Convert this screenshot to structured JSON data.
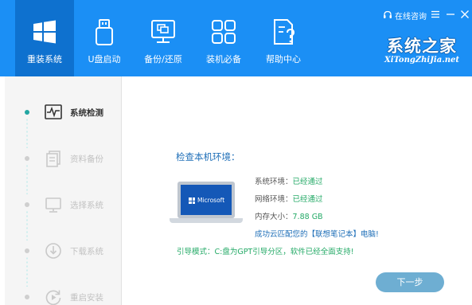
{
  "header": {
    "nav": [
      {
        "label": "重装系统",
        "icon": "windows-logo-icon",
        "active": true
      },
      {
        "label": "U盘启动",
        "icon": "usb-drive-icon",
        "active": false
      },
      {
        "label": "备份/还原",
        "icon": "monitor-backup-icon",
        "active": false
      },
      {
        "label": "装机必备",
        "icon": "apps-grid-icon",
        "active": false
      },
      {
        "label": "帮助中心",
        "icon": "help-document-icon",
        "active": false
      }
    ],
    "consult_label": "在线咨询",
    "brand_title": "系统之家",
    "brand_url": "XiTongZhiJia.net"
  },
  "sidebar": {
    "steps": [
      {
        "label": "系统检测",
        "icon": "pulse-monitor-icon",
        "active": true
      },
      {
        "label": "资料备份",
        "icon": "documents-icon",
        "active": false
      },
      {
        "label": "选择系统",
        "icon": "monitor-icon",
        "active": false
      },
      {
        "label": "下载系统",
        "icon": "download-icon",
        "active": false
      },
      {
        "label": "重启安装",
        "icon": "restart-icon",
        "active": false
      }
    ]
  },
  "main": {
    "check_title": "检查本机环境：",
    "laptop_brand": "Microsoft",
    "system_env": {
      "label": "系统环境：",
      "value": "已经通过"
    },
    "network_env": {
      "label": "网络环境：",
      "value": "已经通过"
    },
    "memory": {
      "label": "内存大小：",
      "value": "7.88 GB"
    },
    "match_message": "成功云匹配您的【联想笔记本】电脑!",
    "boot_message": "引导模式：C:盘为GPT引导分区，软件已经全面支持!",
    "next_button": "下一步"
  },
  "colors": {
    "header_bg": "#1b8ff5",
    "active_nav_bg": "#0e71cf",
    "success_green": "#24aa67",
    "accent_teal": "#22a6a2",
    "link_blue": "#1f6fb8",
    "next_button_bg": "#6eaed2"
  }
}
